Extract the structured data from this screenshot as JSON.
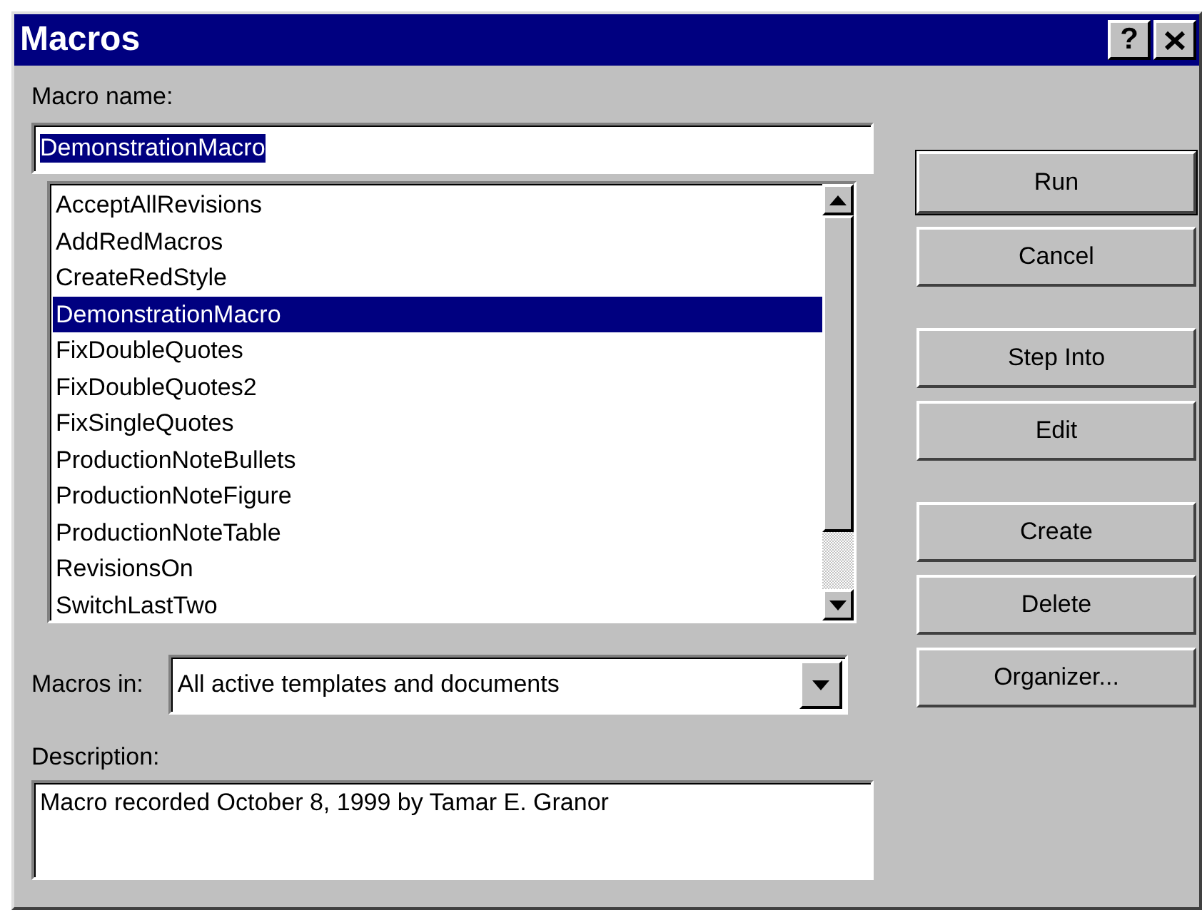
{
  "window": {
    "title": "Macros",
    "help_button": "?"
  },
  "macro_name": {
    "label": "Macro name:",
    "value": "DemonstrationMacro"
  },
  "macros": [
    {
      "name": "AcceptAllRevisions",
      "selected": false
    },
    {
      "name": "AddRedMacros",
      "selected": false
    },
    {
      "name": "CreateRedStyle",
      "selected": false
    },
    {
      "name": "DemonstrationMacro",
      "selected": true
    },
    {
      "name": "FixDoubleQuotes",
      "selected": false
    },
    {
      "name": "FixDoubleQuotes2",
      "selected": false
    },
    {
      "name": "FixSingleQuotes",
      "selected": false
    },
    {
      "name": "ProductionNoteBullets",
      "selected": false
    },
    {
      "name": "ProductionNoteFigure",
      "selected": false
    },
    {
      "name": "ProductionNoteTable",
      "selected": false
    },
    {
      "name": "RevisionsOn",
      "selected": false
    },
    {
      "name": "SwitchLastTwo",
      "selected": false
    }
  ],
  "macros_in": {
    "label": "Macros in:",
    "value": "All active templates and documents"
  },
  "description": {
    "label": "Description:",
    "value": "Macro recorded October 8, 1999 by Tamar E. Granor"
  },
  "button_groups": [
    [
      {
        "label": "Run",
        "default": true
      },
      {
        "label": "Cancel",
        "default": false
      }
    ],
    [
      {
        "label": "Step Into",
        "default": false
      },
      {
        "label": "Edit",
        "default": false
      }
    ],
    [
      {
        "label": "Create",
        "default": false
      },
      {
        "label": "Delete",
        "default": false
      },
      {
        "label": "Organizer...",
        "default": false
      }
    ]
  ]
}
